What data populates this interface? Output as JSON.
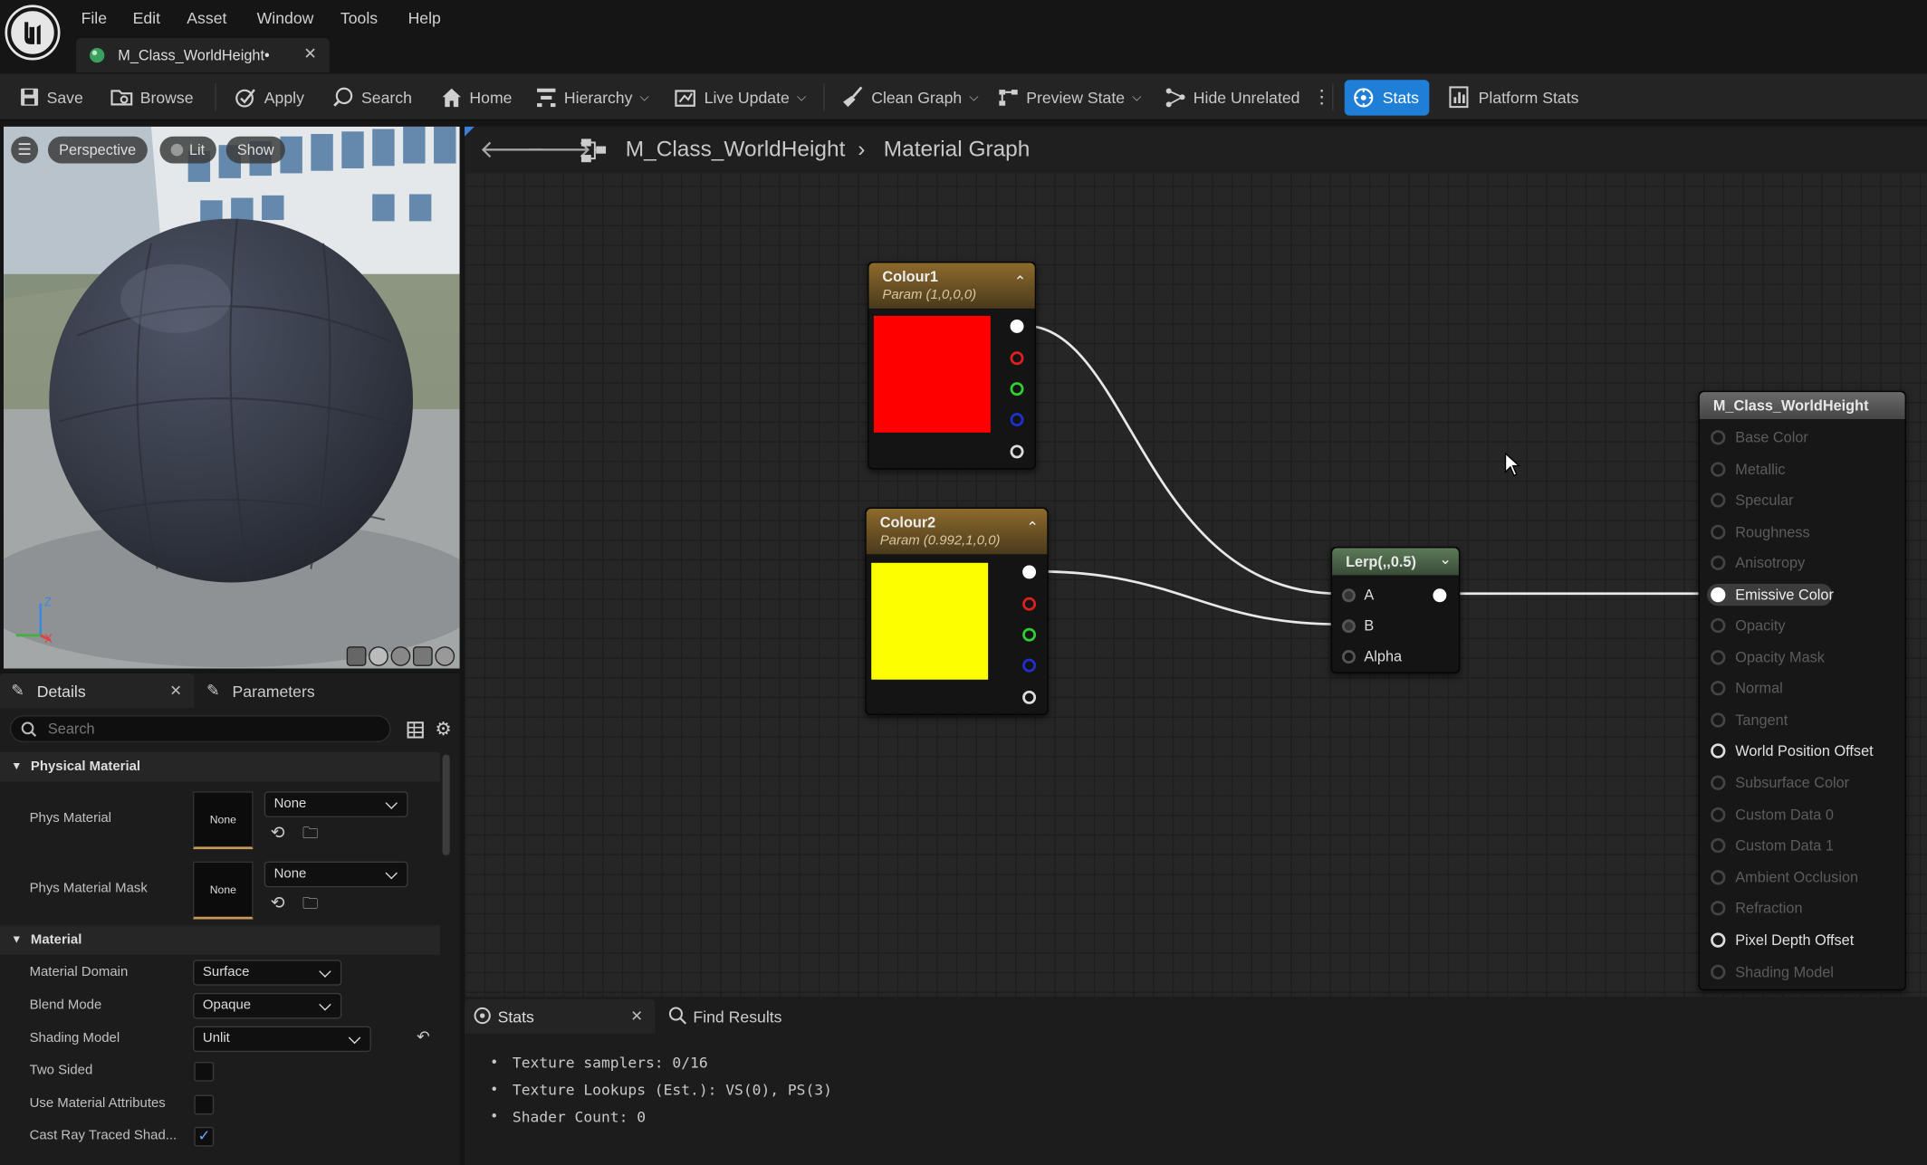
{
  "menu": [
    "File",
    "Edit",
    "Asset",
    "Window",
    "Tools",
    "Help"
  ],
  "tab": {
    "title": "M_Class_WorldHeight•"
  },
  "toolbar": {
    "save": "Save",
    "browse": "Browse",
    "apply": "Apply",
    "search": "Search",
    "home": "Home",
    "hierarchy": "Hierarchy",
    "live_update": "Live Update",
    "clean_graph": "Clean Graph",
    "preview_state": "Preview State",
    "hide_unrelated": "Hide Unrelated",
    "stats": "Stats",
    "platform_stats": "Platform Stats"
  },
  "viewport": {
    "perspective": "Perspective",
    "lit": "Lit",
    "show": "Show",
    "axis_z": "Z",
    "axis_x": "X"
  },
  "details": {
    "tab_details": "Details",
    "tab_parameters": "Parameters",
    "search_placeholder": "Search",
    "section_physical": "Physical Material",
    "phys_material": "Phys Material",
    "phys_material_value": "None",
    "phys_material_thumb": "None",
    "phys_material_mask": "Phys Material Mask",
    "phys_material_mask_value": "None",
    "phys_material_mask_thumb": "None",
    "section_material": "Material",
    "material_domain": "Material Domain",
    "material_domain_value": "Surface",
    "blend_mode": "Blend Mode",
    "blend_mode_value": "Opaque",
    "shading_model": "Shading Model",
    "shading_model_value": "Unlit",
    "two_sided": "Two Sided",
    "use_material_attributes": "Use Material Attributes",
    "cast_ray_traced": "Cast Ray Traced Shad..."
  },
  "breadcrumb": {
    "asset": "M_Class_WorldHeight",
    "graph": "Material Graph"
  },
  "nodes": {
    "colour1": {
      "title": "Colour1",
      "subtitle": "Param (1,0,0,0)",
      "color": "#ff0000"
    },
    "colour2": {
      "title": "Colour2",
      "subtitle": "Param (0.992,1,0,0)",
      "color": "#fdff00"
    },
    "lerp": {
      "title": "Lerp(,,0.5)",
      "input_a": "A",
      "input_b": "B",
      "input_alpha": "Alpha"
    },
    "result": {
      "title": "M_Class_WorldHeight",
      "props": [
        "Base Color",
        "Metallic",
        "Specular",
        "Roughness",
        "Anisotropy",
        "Emissive Color",
        "Opacity",
        "Opacity Mask",
        "Normal",
        "Tangent",
        "World Position Offset",
        "Subsurface Color",
        "Custom Data 0",
        "Custom Data 1",
        "Ambient Occlusion",
        "Refraction",
        "Pixel Depth Offset",
        "Shading Model"
      ]
    }
  },
  "bottom": {
    "tab_stats": "Stats",
    "tab_find": "Find Results",
    "lines": [
      "Texture samplers: 0/16",
      "Texture Lookups (Est.): VS(0), PS(3)",
      "Shader Count: 0"
    ]
  }
}
